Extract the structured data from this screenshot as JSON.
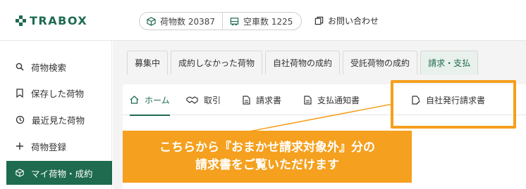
{
  "header": {
    "logo_text": "TRABOX",
    "cargo_count_label": "荷物数 20387",
    "truck_count_label": "空車数 1225",
    "contact_label": "お問い合わせ"
  },
  "sidebar": {
    "items": [
      {
        "label": "荷物検索",
        "icon": "search-icon"
      },
      {
        "label": "保存した荷物",
        "icon": "bookmark-icon"
      },
      {
        "label": "最近見た荷物",
        "icon": "history-icon"
      },
      {
        "label": "荷物登録",
        "icon": "plus-icon"
      },
      {
        "label": "マイ荷物・成約",
        "icon": "box-icon",
        "active": true
      }
    ]
  },
  "main": {
    "tabs": [
      {
        "label": "募集中"
      },
      {
        "label": "成約しなかった荷物"
      },
      {
        "label": "自社荷物の成約"
      },
      {
        "label": "受託荷物の成約"
      },
      {
        "label": "請求・支払",
        "active": true
      }
    ],
    "subtabs": [
      {
        "label": "ホーム",
        "icon": "home-icon",
        "active": true
      },
      {
        "label": "取引",
        "icon": "handshake-icon"
      },
      {
        "label": "請求書",
        "icon": "document-icon"
      },
      {
        "label": "支払通知書",
        "icon": "document-icon"
      },
      {
        "label": "自社発行請求書",
        "icon": "document-edit-icon"
      }
    ]
  },
  "callout": {
    "line1": "こちらから『おまかせ請求対象外』分の",
    "line2": "請求書をご覧いただけます"
  },
  "colors": {
    "brand_green": "#1e6b4f",
    "accent_orange": "#f5a01e"
  }
}
